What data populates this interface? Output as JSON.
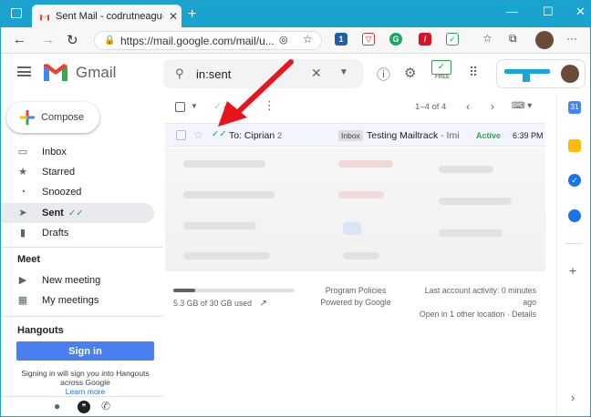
{
  "browser": {
    "tab_title": "Sent Mail - codrutneagu@digita",
    "tab_close": "✕",
    "new_tab": "+",
    "url": "https://mail.google.com/mail/u...",
    "controls": {
      "minimize": "—",
      "maximize": "☐",
      "close": "✕"
    }
  },
  "gmail": {
    "brand": "Gmail",
    "search_value": "in:sent",
    "addon_label": "FREE"
  },
  "sidebar": {
    "compose": "Compose",
    "items": [
      {
        "label": "Inbox",
        "icon": "inbox-icon"
      },
      {
        "label": "Starred",
        "icon": "star-icon"
      },
      {
        "label": "Snoozed",
        "icon": "clock-icon"
      },
      {
        "label": "Sent",
        "icon": "send-icon",
        "active": true
      },
      {
        "label": "Drafts",
        "icon": "draft-icon"
      }
    ],
    "meet_title": "Meet",
    "meet_items": [
      {
        "label": "New meeting",
        "icon": "video-icon"
      },
      {
        "label": "My meetings",
        "icon": "calendar-icon"
      }
    ],
    "hangouts_title": "Hangouts",
    "signin_button": "Sign in",
    "hint": "Signing in will sign you into Hangouts across Google",
    "learn_more": "Learn more"
  },
  "toolbar": {
    "pagination": "1–4 of 4"
  },
  "email_row": {
    "recipient": "To: Ciprian",
    "thread_count": "2",
    "label": "Inbox",
    "subject": "Testing Mailtrack",
    "snippet": " - Imi",
    "status": "Active",
    "time": "6:39 PM"
  },
  "footer": {
    "storage": "5.3 GB of 30 GB used",
    "storage_fraction": 0.18,
    "policies": "Program Policies",
    "powered": "Powered by Google",
    "activity_line1": "Last account activity: 0 minutes",
    "activity_line2": "ago",
    "activity_line3": "Open in 1 other location · Details"
  },
  "colors": {
    "titlebar": "#1aa3cf",
    "accent_blue": "#4a7ff0",
    "mailtrack_green": "#2ea44f",
    "arrow_red": "#e8141e"
  }
}
